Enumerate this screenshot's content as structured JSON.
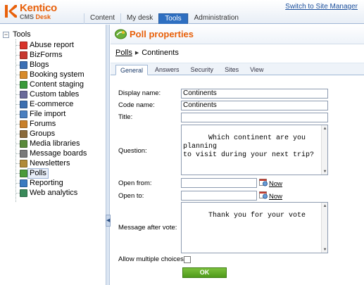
{
  "app": {
    "logo_word": "Kentico",
    "logo_sub_cms": "CMS",
    "logo_sub_desk": "Desk",
    "switch_link": "Switch to Site Manager"
  },
  "top_tabs": [
    {
      "label": "Content",
      "active": false
    },
    {
      "label": "My desk",
      "active": false
    },
    {
      "label": "Tools",
      "active": true
    },
    {
      "label": "Administration",
      "active": false
    }
  ],
  "tree": {
    "root": "Tools",
    "items": [
      {
        "label": "Abuse report",
        "icon": "abuse-report-icon",
        "color": "#d9342b"
      },
      {
        "label": "BizForms",
        "icon": "bizforms-icon",
        "color": "#c8382f"
      },
      {
        "label": "Blogs",
        "icon": "blogs-icon",
        "color": "#3a6fb5"
      },
      {
        "label": "Booking system",
        "icon": "booking-system-icon",
        "color": "#d78a2a"
      },
      {
        "label": "Content staging",
        "icon": "content-staging-icon",
        "color": "#3a9a3a"
      },
      {
        "label": "Custom tables",
        "icon": "custom-tables-icon",
        "color": "#6a6a9a"
      },
      {
        "label": "E-commerce",
        "icon": "shopping-cart-icon",
        "color": "#3c6fb0"
      },
      {
        "label": "File import",
        "icon": "file-import-icon",
        "color": "#4a7fc0"
      },
      {
        "label": "Forums",
        "icon": "forums-icon",
        "color": "#c8802a"
      },
      {
        "label": "Groups",
        "icon": "groups-icon",
        "color": "#8a6a3a"
      },
      {
        "label": "Media libraries",
        "icon": "media-libraries-icon",
        "color": "#5a8a3a"
      },
      {
        "label": "Message boards",
        "icon": "message-boards-icon",
        "color": "#7a7a7a"
      },
      {
        "label": "Newsletters",
        "icon": "newsletters-icon",
        "color": "#b08a3a"
      },
      {
        "label": "Polls",
        "icon": "polls-icon",
        "color": "#4a9a3a",
        "selected": true
      },
      {
        "label": "Reporting",
        "icon": "reporting-icon",
        "color": "#3a7ac0"
      },
      {
        "label": "Web analytics",
        "icon": "web-analytics-icon",
        "color": "#3a8a5a"
      }
    ]
  },
  "page": {
    "title": "Poll properties",
    "breadcrumb_link": "Polls",
    "breadcrumb_current": "Continents"
  },
  "sub_tabs": [
    {
      "label": "General",
      "active": true
    },
    {
      "label": "Answers",
      "active": false
    },
    {
      "label": "Security",
      "active": false
    },
    {
      "label": "Sites",
      "active": false
    },
    {
      "label": "View",
      "active": false
    }
  ],
  "form": {
    "display_name_label": "Display name:",
    "display_name_value": "Continents",
    "code_name_label": "Code name:",
    "code_name_value": "Continents",
    "title_label": "Title:",
    "title_value": "",
    "question_label": "Question:",
    "question_value": "Which continent are you planning\nto visit during your next trip?",
    "open_from_label": "Open from:",
    "open_from_value": "",
    "open_to_label": "Open to:",
    "open_to_value": "",
    "now_label": "Now",
    "message_after_vote_label": "Message after vote:",
    "message_after_vote_value": "Thank you for your vote",
    "allow_multiple_label": "Allow multiple choices:",
    "allow_multiple_checked": false,
    "ok_label": "OK"
  },
  "colors": {
    "accent_orange": "#e8600a",
    "active_tab_blue": "#2e6fc1",
    "ok_green": "#5aa61f"
  }
}
